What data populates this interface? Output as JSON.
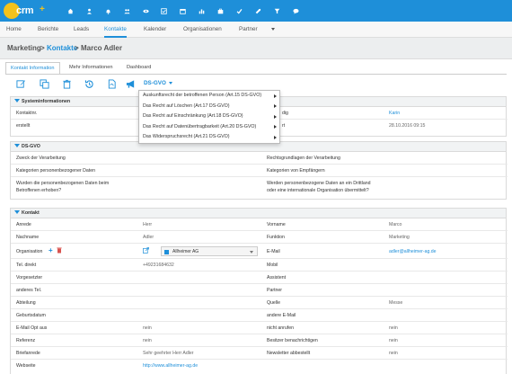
{
  "app": {
    "logo": "crm",
    "logo_plus": "+"
  },
  "topbar": {
    "icons": [
      "home-icon",
      "user-icon",
      "bell-icon",
      "users-icon",
      "eye-icon",
      "checkbox-icon",
      "calendar-icon",
      "bar-chart-icon",
      "briefcase-icon",
      "check-icon",
      "wrench-icon",
      "filter-icon",
      "chat-icon"
    ]
  },
  "nav": {
    "items": [
      {
        "label": "Home"
      },
      {
        "label": "Berichte"
      },
      {
        "label": "Leads"
      },
      {
        "label": "Kontakte"
      },
      {
        "label": "Kalender"
      },
      {
        "label": "Organisationen"
      },
      {
        "label": "Partner"
      }
    ]
  },
  "breadcrumb": {
    "root": "Marketing",
    "section": "Kontakte",
    "current": "Marco Adler",
    "sep": ">"
  },
  "tabs": [
    {
      "label": "Kontakt Information"
    },
    {
      "label": "Mehr Informationen"
    },
    {
      "label": "Dashboard"
    }
  ],
  "toolbar": {
    "dsgvo_label": "DS-GVO"
  },
  "dsgvo_menu": [
    "Auskunftsrecht der betroffenen Person (Art.15 DS-GVO)",
    "Das Recht auf Löschen (Art.17 DS-GVO)",
    "Das Recht auf Einschränkung (Art.18 DS-GVO)",
    "Das Recht auf Datenübertragbarkeit (Art.20 DS-GVO)",
    "Das Widerspruchsrecht (Art.21 DS-GVO)"
  ],
  "system": {
    "title": "Systeminformationen",
    "kontaktnr_label": "Kontaktnr.",
    "erstellt_label": "erstellt",
    "right1_label": "dig",
    "right1_value": "Karin",
    "right2_label": "rt",
    "right2_value": "28.10.2016 09:15"
  },
  "dsgvo": {
    "title": "DS-GVO",
    "zweck": "Zweck der Verarbeitung",
    "rechtsgrundlagen": "Rechtsgrundlagen der Verarbeitung",
    "kategorien_daten": "Kategorien personenbezogener Daten",
    "kategorien_empfaenger": "Kategorien von Empfängern",
    "betroffen_1": "Wurden die personenbezogenen Daten beim",
    "betroffen_2": "Betroffenen erhoben?",
    "drittland_1": "Werden personenbezogene Daten an ein Drittland",
    "drittland_2": "oder eine internationale Organisation übermittelt?"
  },
  "kontakt": {
    "title": "Kontakt",
    "rows": [
      {
        "l": "Anrede",
        "v": "Herr",
        "rl": "Vorname",
        "rv": "Marco"
      },
      {
        "l": "Nachname",
        "v": "Adler",
        "rl": "Funktion",
        "rv": "Marketing"
      },
      {
        "l": "Organisation",
        "v": "",
        "rl": "E-Mail",
        "rv": "adler@allheimer-ag.de"
      },
      {
        "l": "Tel. direkt",
        "v": "+49231684632",
        "rl": "Mobil",
        "rv": ""
      },
      {
        "l": "Vorgesetzter",
        "v": "",
        "rl": "Assistent",
        "rv": ""
      },
      {
        "l": "anderes Tel.",
        "v": "",
        "rl": "Partner",
        "rv": ""
      },
      {
        "l": "Abteilung",
        "v": "",
        "rl": "Quelle",
        "rv": "Messe"
      },
      {
        "l": "Geburtsdatum",
        "v": "",
        "rl": "andere E-Mail",
        "rv": ""
      },
      {
        "l": "E-Mail Opt aus",
        "v": "nein",
        "rl": "nicht anrufen",
        "rv": "nein"
      },
      {
        "l": "Referenz",
        "v": "nein",
        "rl": "Besitzer benachrichtigen",
        "rv": "nein"
      },
      {
        "l": "Briefanrede",
        "v": "Sehr geehrter Herr Adler",
        "rl": "Newsletter abbestellt",
        "rv": "nein"
      },
      {
        "l": "Webseite",
        "v": "http://www.allheimer-ag.de",
        "rl": "",
        "rv": ""
      }
    ],
    "org_value": "Allheimer AG"
  }
}
